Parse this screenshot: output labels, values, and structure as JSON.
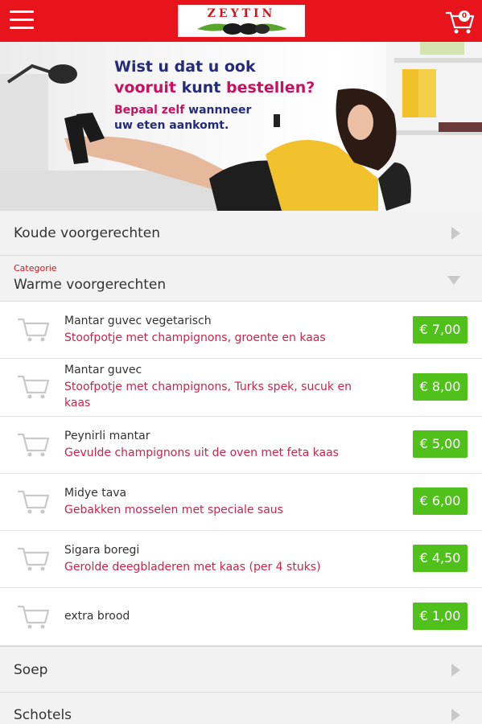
{
  "header": {
    "logo_text": "ZEYTIN",
    "cart_count": "0",
    "accent": "#e8141b"
  },
  "banner": {
    "line1": "Wist u dat u ook",
    "line2_a": "vooruit",
    "line2_b": "kunt",
    "line2_c": "bestellen?",
    "line3_a": "Bepaal zelf",
    "line3_b": "wannneer",
    "line4": "uw eten aankomt."
  },
  "categories": {
    "koude": "Koude voorgerechten",
    "category_label": "Categorie",
    "warme": "Warme voorgerechten",
    "soep": "Soep",
    "schotels": "Schotels"
  },
  "products": [
    {
      "name": "Mantar guvec vegetarisch",
      "desc": "Stoofpotje met champignons, groente en kaas",
      "price": "€ 7,00"
    },
    {
      "name": "Mantar guvec",
      "desc": "Stoofpotje met champignons, Turks spek, sucuk en kaas",
      "price": "€ 8,00"
    },
    {
      "name": "Peynirli mantar",
      "desc": "Gevulde champignons uit de oven met feta kaas",
      "price": "€ 5,00"
    },
    {
      "name": "Midye tava",
      "desc": "Gebakken mosselen met speciale saus",
      "price": "€ 6,00"
    },
    {
      "name": "Sigara boregi",
      "desc": "Gerolde deegbladeren met kaas (per 4 stuks)",
      "price": "€ 4,50"
    },
    {
      "name": "extra brood",
      "desc": "",
      "price": "€ 1,00"
    }
  ]
}
